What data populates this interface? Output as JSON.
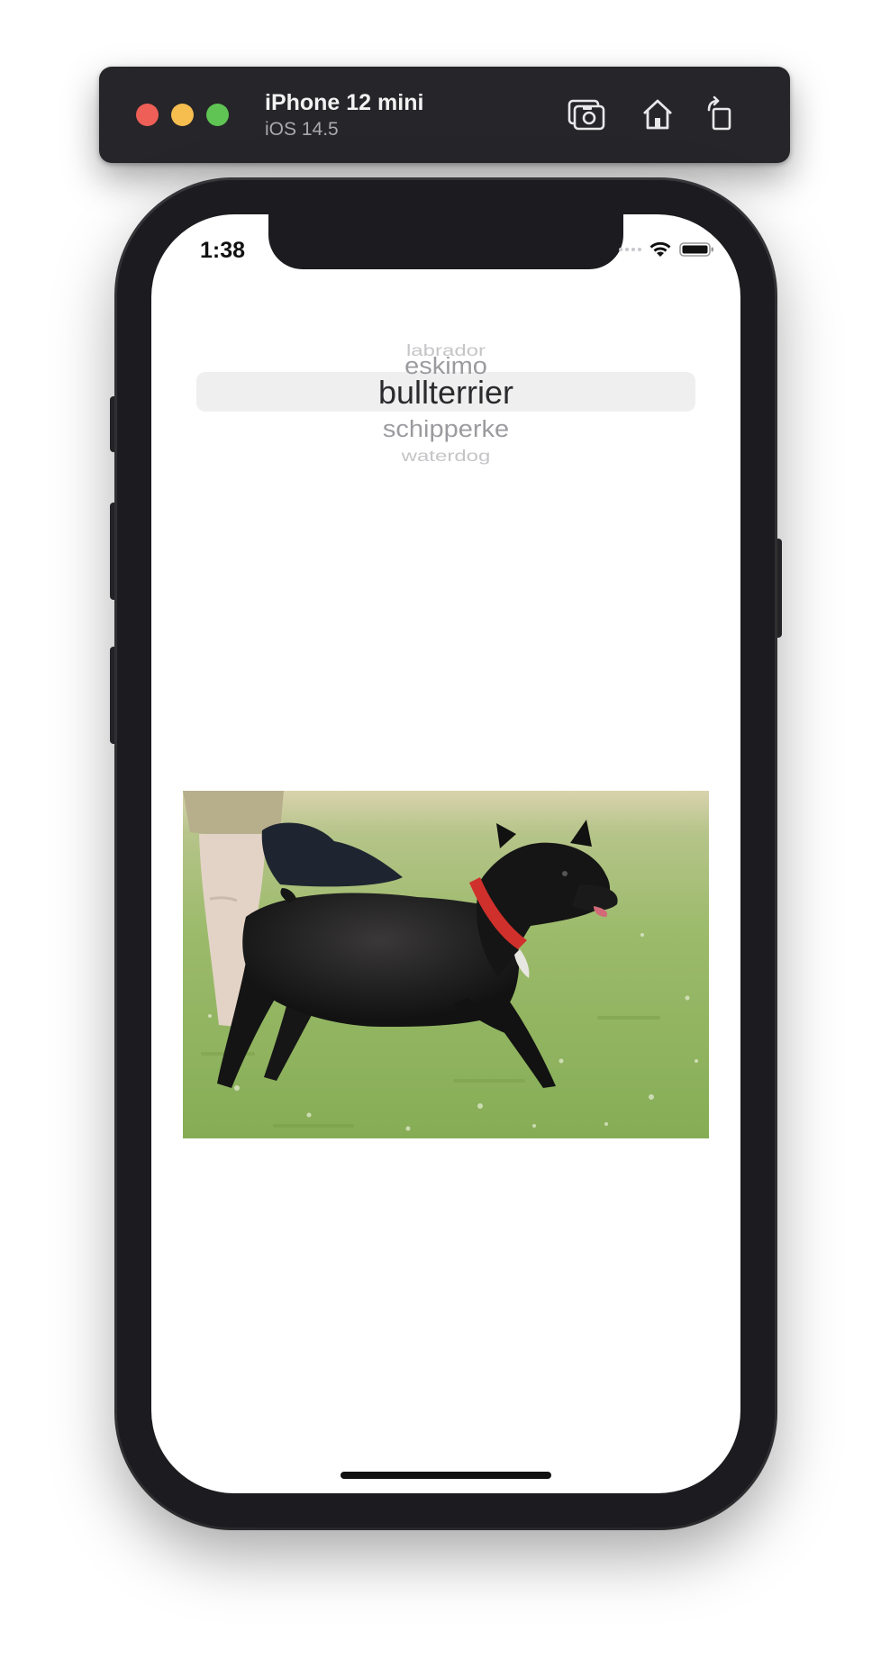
{
  "simulator": {
    "device_name": "iPhone 12 mini",
    "os_version": "iOS 14.5",
    "icons": [
      "screenshot-icon",
      "home-icon",
      "rotate-icon"
    ]
  },
  "status_bar": {
    "time": "1:38",
    "icons": [
      "signal-icon",
      "wifi-icon",
      "battery-icon"
    ]
  },
  "picker": {
    "items": [
      "labrador",
      "eskimo",
      "bullterrier",
      "schipperke",
      "waterdog"
    ],
    "selected": "bullterrier"
  },
  "image": {
    "subject": "dog-photo"
  }
}
